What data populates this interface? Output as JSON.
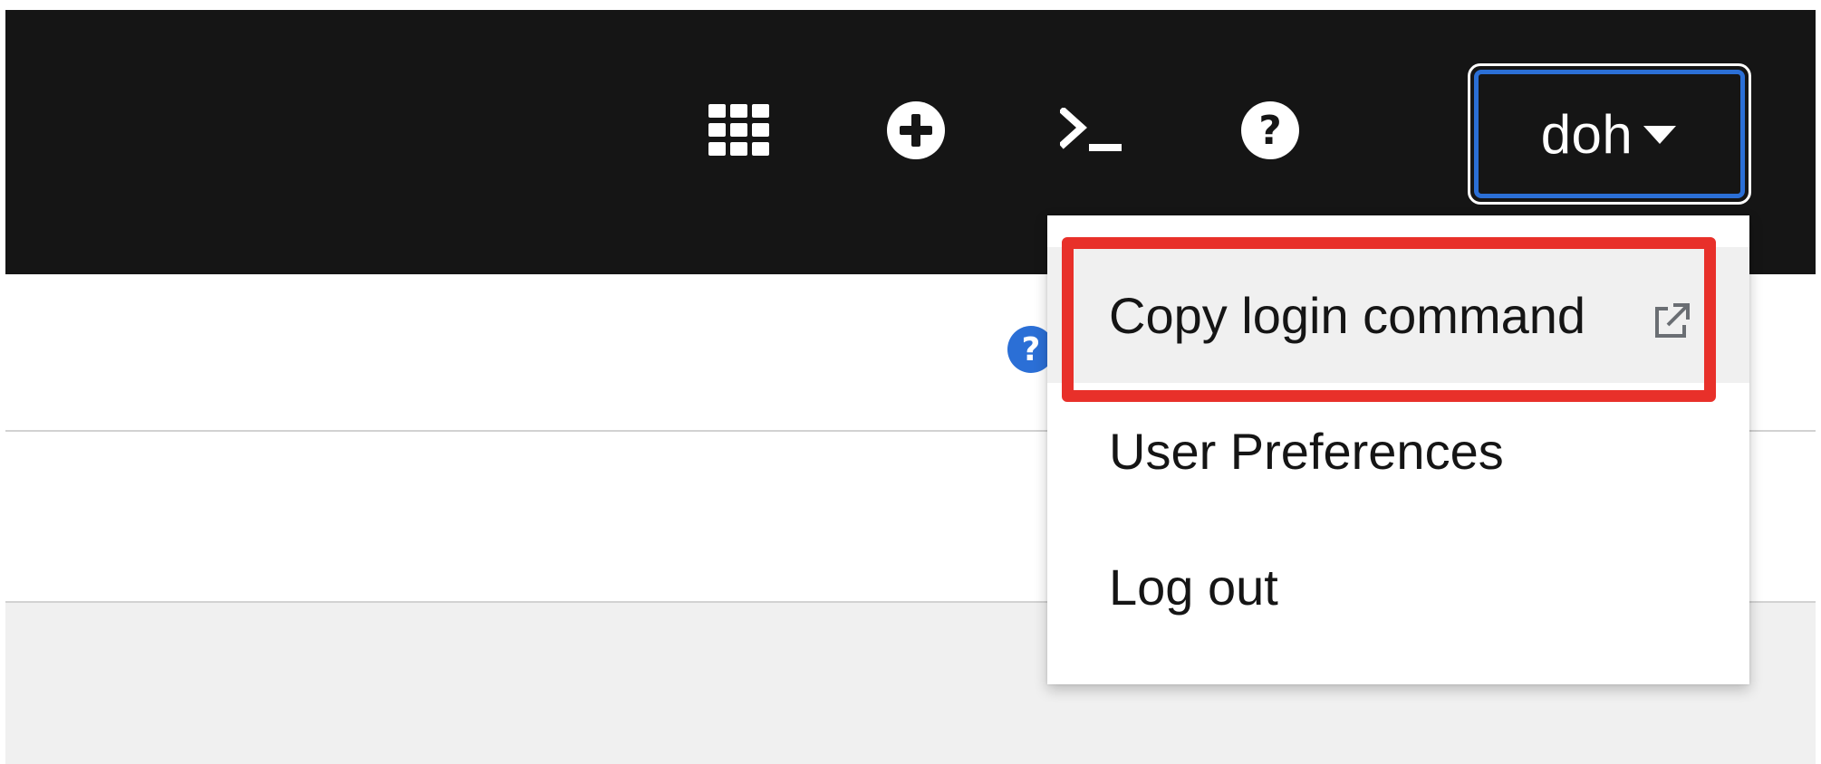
{
  "masthead": {
    "tools": [
      {
        "icon": "app-launcher-grid-icon"
      },
      {
        "icon": "plus-circle-icon"
      },
      {
        "icon": "terminal-icon"
      },
      {
        "icon": "help-circle-icon"
      }
    ],
    "user_menu": {
      "username": "doh",
      "caret_icon": "caret-down-icon"
    }
  },
  "page": {
    "help_icon": "help-circle-icon"
  },
  "dropdown": {
    "items": [
      {
        "label": "Copy login command",
        "icon": "external-link-icon",
        "hovered": true
      },
      {
        "label": "User Preferences"
      },
      {
        "label": "Log out"
      }
    ]
  },
  "annotation": {
    "highlight_color": "#e8302a"
  },
  "colors": {
    "masthead_bg": "#151515",
    "focus_ring": "#2b6fd6",
    "help_blue": "#2b6fd6",
    "hover_bg": "#f0f0f0",
    "text": "#151515"
  }
}
